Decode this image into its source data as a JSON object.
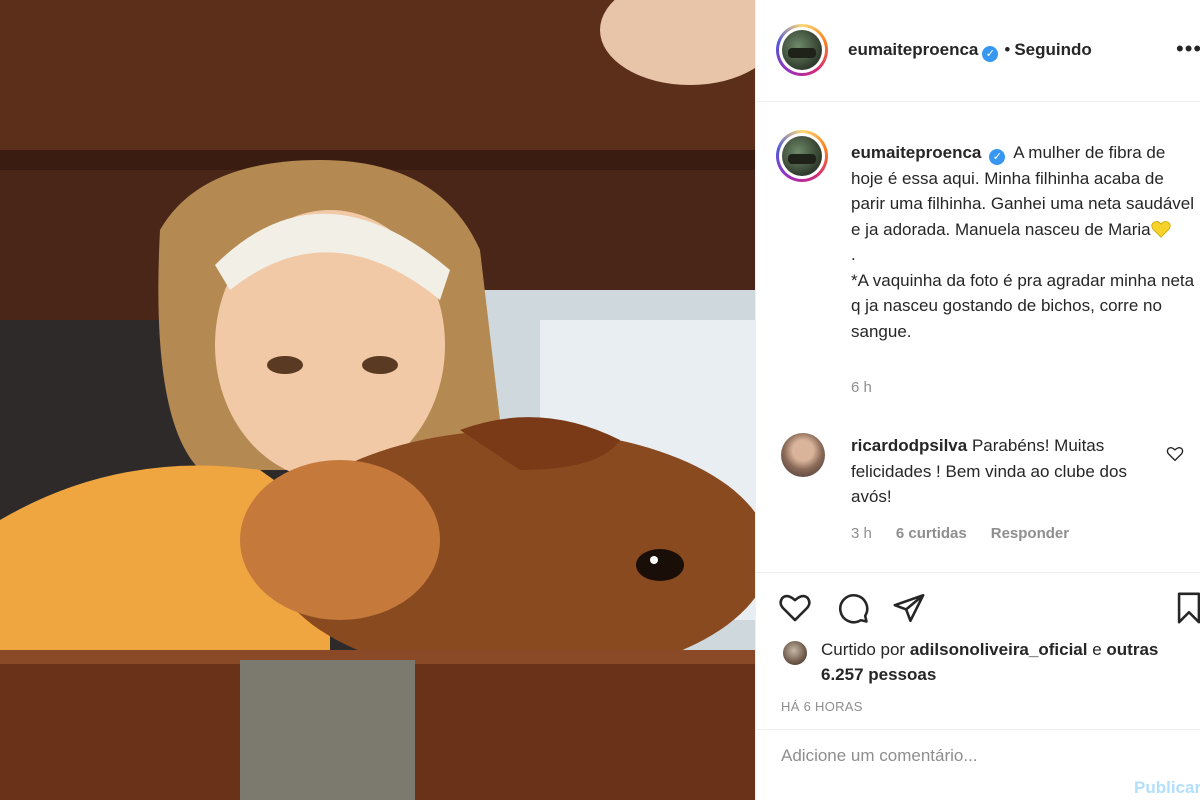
{
  "post": {
    "username": "eumaiteproenca",
    "follow_status": "Seguindo",
    "more_label": "•••",
    "separator": "•"
  },
  "caption": {
    "username": "eumaiteproenca",
    "text": "A mulher de fibra de hoje é essa aqui. Minha filhinha acaba de parir uma filhinha. Ganhei uma neta saudável e ja adorada. Manuela nasceu de Maria",
    "dot_line": ".",
    "extra": "*A vaquinha da foto é pra agradar minha neta q ja nasceu gostando de bichos, corre no sangue.",
    "time": "6 h"
  },
  "comment": {
    "username": "ricardodpsilva",
    "text": "Parabéns! Muitas felicidades ! Bem vinda ao clube dos avós!",
    "time": "3 h",
    "likes": "6 curtidas",
    "reply": "Responder"
  },
  "likes": {
    "prefix": "Curtido por",
    "user": "adilsonoliveira_oficial",
    "and": "e",
    "others": "outras 6.257 pessoas"
  },
  "date": "HÁ 6 HORAS",
  "add_comment": {
    "placeholder": "Adicione um comentário...",
    "publish": "Publicar"
  },
  "icons": {
    "like": "heart-outline-icon",
    "comment": "comment-bubble-icon",
    "share": "paper-plane-icon",
    "save": "bookmark-icon"
  },
  "colors": {
    "text": "#262626",
    "secondary": "#8e8e8e",
    "verified": "#3897f0",
    "publish_disabled": "#b2dffc"
  }
}
